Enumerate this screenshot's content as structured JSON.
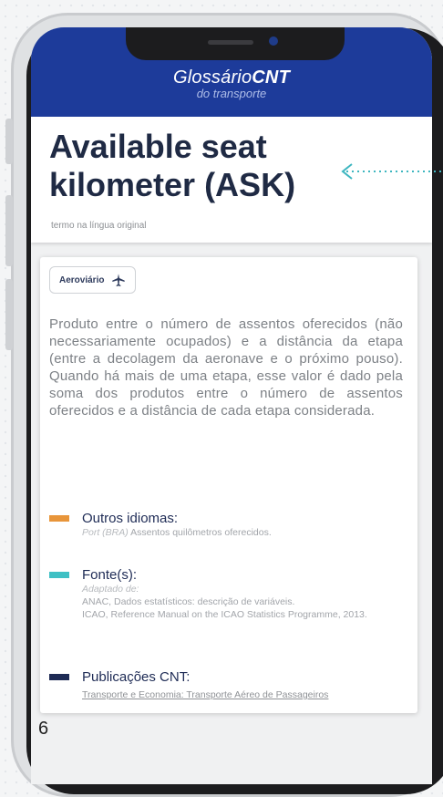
{
  "app": {
    "brand_main": "Glossário",
    "brand_bold": "CNT",
    "brand_sub": "do transporte"
  },
  "term": {
    "title": "Available seat kilometer (ASK)",
    "subtitle": "termo na língua original"
  },
  "category_tag": {
    "label": "Aeroviário",
    "icon": "airplane-icon"
  },
  "definition": "Produto entre o número de assentos oferecidos (não necessariamente ocupados) e a distância da etapa (entre a decolagem da aeronave e o próximo pouso). Quando há mais de uma etapa, esse valor é dado pela soma dos produtos entre o número de assentos oferecidos e a distância de cada etapa considerada.",
  "sections": {
    "other_languages": {
      "title": "Outros idiomas:",
      "lang": "Port (BRA)",
      "text": "Assentos quilômetros oferecidos.",
      "color": "#e8953a"
    },
    "sources": {
      "title": "Fonte(s):",
      "adapted": "Adaptado de:",
      "line1": "ANAC, Dados estatísticos: descrição de variáveis.",
      "line2": "ICAO, Reference Manual on the ICAO Statistics Programme, 2013.",
      "color": "#3fc0c4"
    },
    "publications": {
      "title": "Publicações CNT:",
      "link": "Transporte e Economia: Transporte Aéreo de Passageiros",
      "color": "#1e2b55"
    }
  },
  "page_number": "6",
  "colors": {
    "header": "#1d3b9a",
    "arrow": "#3fb6c0"
  }
}
